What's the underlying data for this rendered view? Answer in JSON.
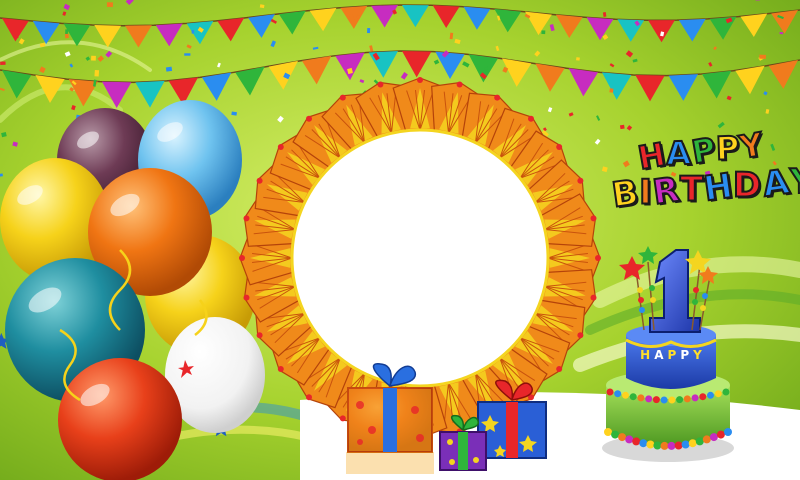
{
  "scene": {
    "headline_line1": "HAPPY",
    "headline_line2": "BIRTHDAY",
    "cake_number": "1",
    "cake_label": "HAPPY",
    "photo_frame": "empty",
    "headline_letter_colors": [
      "#e8262a",
      "#2a8df0",
      "#2fb53b",
      "#ffd21e",
      "#f07b1d",
      "#c72cc0",
      "#e8262a",
      "#2a8df0"
    ],
    "colors": {
      "background": "#9ccf2b",
      "frame": "#f08a1a",
      "frame_accent": "#f4d520",
      "cake_top": "#2a52c8",
      "cake_bottom": "#7cc444",
      "cake_number": "#2c4fd0"
    }
  }
}
